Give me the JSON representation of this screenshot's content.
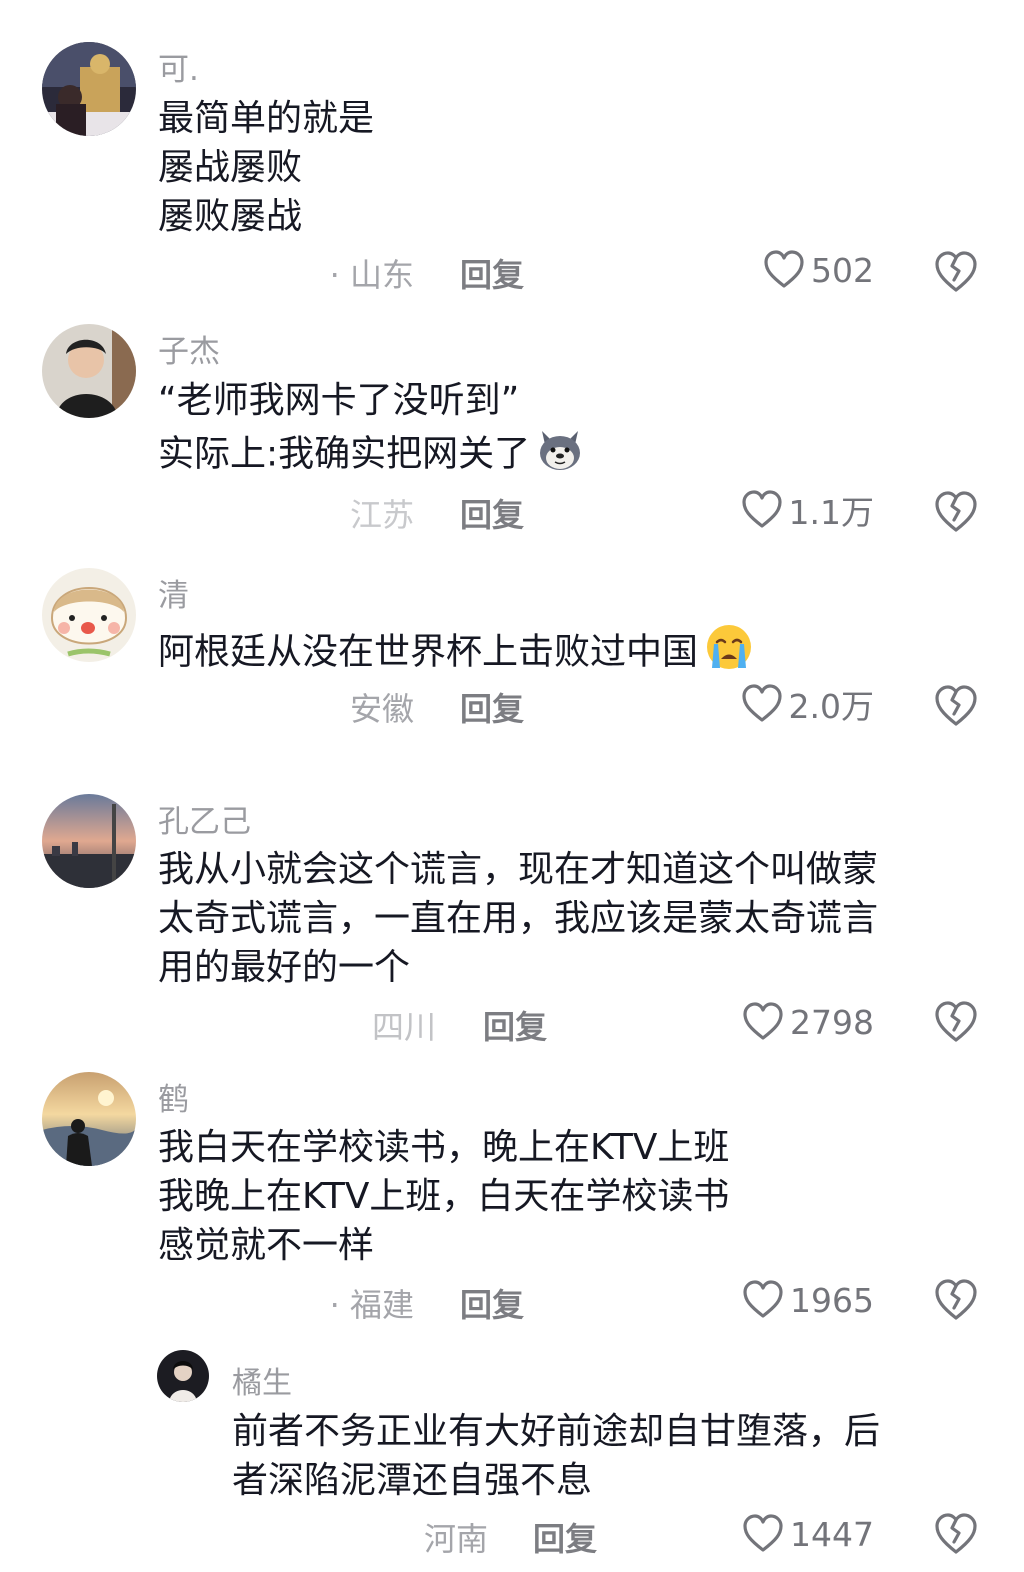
{
  "comments": [
    {
      "username": "可.",
      "lines": [
        "最简单的就是",
        "屡战屡败",
        "屡败屡战"
      ],
      "location": "· 山东",
      "reply": "回复",
      "likes": "502"
    },
    {
      "username": "子杰",
      "lines": [
        "“老师我网卡了没听到”",
        "实际上:我确实把网关了"
      ],
      "emoji": "dog-emoji",
      "location": "江苏",
      "reply": "回复",
      "likes": "1.1万"
    },
    {
      "username": "清",
      "lines": [
        "阿根廷从没在世界杯上击败过中国"
      ],
      "emoji": "crying-face-emoji",
      "location": "安徽",
      "reply": "回复",
      "likes": "2.0万"
    },
    {
      "username": "孔乙己",
      "lines": [
        "我从小就会这个谎言，现在才知道这个叫做蒙",
        "太奇式谎言，一直在用，我应该是蒙太奇谎言",
        "用的最好的一个"
      ],
      "location": "四川",
      "reply": "回复",
      "likes": "2798"
    },
    {
      "username": "鹤",
      "lines": [
        "我白天在学校读书，晚上在KTV上班",
        "我晚上在KTV上班，白天在学校读书",
        "感觉就不一样"
      ],
      "location": "· 福建",
      "reply": "回复",
      "likes": "1965"
    },
    {
      "username": "橘生",
      "lines": [
        "前者不务正业有大好前途却自甘堕落，后",
        "者深陷泥潭还自强不息"
      ],
      "location": "河南",
      "reply": "回复",
      "likes": "1447"
    }
  ],
  "colors": {
    "text": "#161823",
    "secondary": "#9a9ba0",
    "icon": "#73747a"
  }
}
